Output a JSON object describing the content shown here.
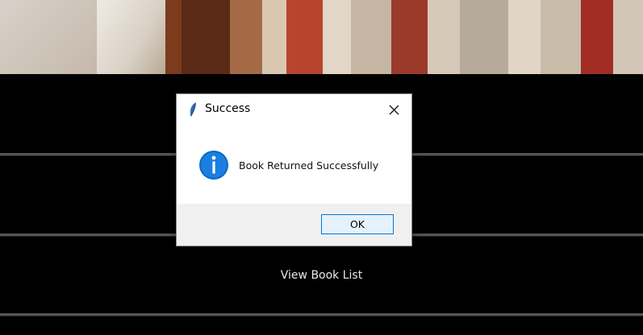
{
  "dialog": {
    "title": "Success",
    "message": "Book Returned Successfully",
    "ok_label": "OK",
    "icon": "info-icon",
    "accent": "#0078d7"
  },
  "menu": {
    "items": [
      {
        "label": ""
      },
      {
        "label": ""
      },
      {
        "label": "View Book List"
      },
      {
        "label": ""
      }
    ]
  },
  "colors": {
    "background": "#000000",
    "divider": "#555555",
    "dialog_footer": "#f0f0f0"
  }
}
